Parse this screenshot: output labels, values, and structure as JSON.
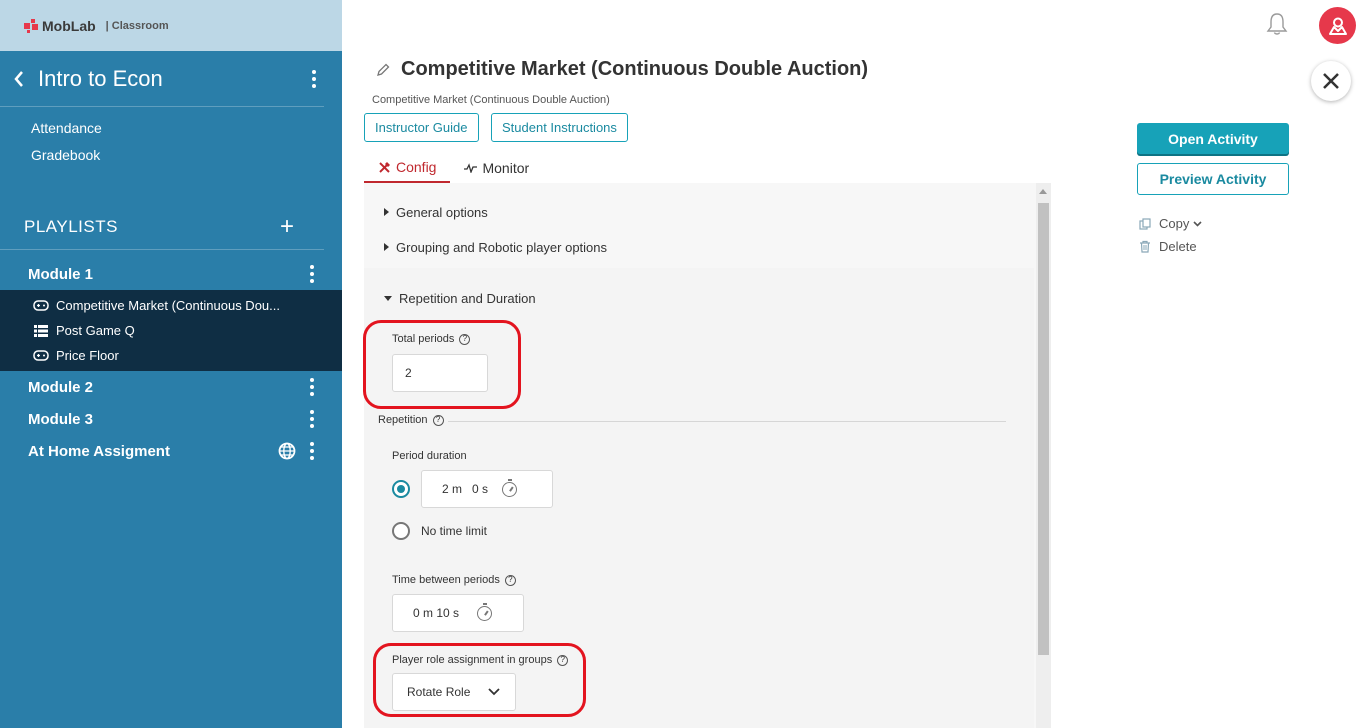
{
  "brand": {
    "name": "MobLab",
    "product": "Classroom"
  },
  "sidebar": {
    "course_title": "Intro to Econ",
    "links": [
      "Attendance",
      "Gradebook"
    ],
    "playlists_title": "PLAYLISTS",
    "modules": [
      {
        "label": "Module 1",
        "items": [
          {
            "label": "Competitive Market (Continuous Dou...",
            "icon": "gamepad-icon"
          },
          {
            "label": "Post Game Q",
            "icon": "list-icon"
          },
          {
            "label": "Price Floor",
            "icon": "gamepad-icon"
          }
        ]
      },
      {
        "label": "Module 2"
      },
      {
        "label": "Module 3"
      },
      {
        "label": "At Home Assigment"
      }
    ]
  },
  "header": {
    "title": "Competitive Market (Continuous Double Auction)",
    "subtitle": "Competitive Market (Continuous Double Auction)",
    "instructor_guide": "Instructor Guide",
    "student_instructions": "Student Instructions"
  },
  "tabs": [
    {
      "label": "Config",
      "active": true
    },
    {
      "label": "Monitor",
      "active": false
    }
  ],
  "config": {
    "sections": {
      "general": "General options",
      "grouping": "Grouping and Robotic player options",
      "repetition": "Repetition and Duration"
    },
    "total_periods_label": "Total periods",
    "total_periods_value": "2",
    "repetition_label": "Repetition",
    "period_duration_label": "Period duration",
    "period_duration_value": "2 m   0 s",
    "no_time_limit_label": "No time limit",
    "time_between_label": "Time between periods",
    "time_between_value": "0 m 10 s",
    "role_assignment_label": "Player role assignment in groups",
    "role_assignment_value": "Rotate Role"
  },
  "actions": {
    "open": "Open Activity",
    "preview": "Preview Activity",
    "copy": "Copy",
    "delete": "Delete"
  },
  "colors": {
    "accent": "#17a2b8",
    "sidebar": "#2a7ea9",
    "highlight": "#e3141f",
    "avatar": "#e6384b"
  }
}
